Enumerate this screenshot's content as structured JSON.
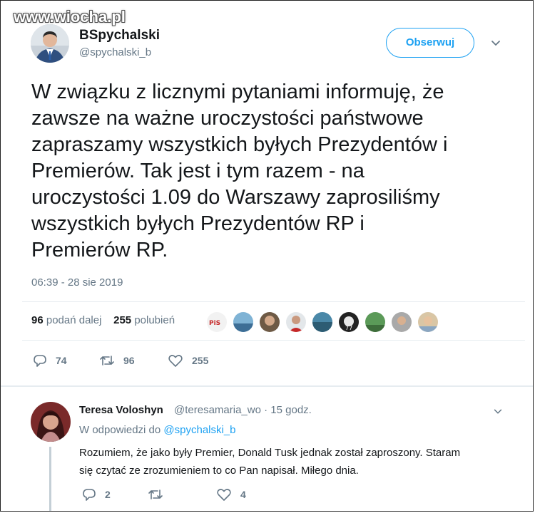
{
  "watermark": "www.wiocha.pl",
  "tweet": {
    "author_name": "BSpychalski",
    "author_handle": "@spychalski_b",
    "follow_label": "Obserwuj",
    "text": "W związku z licznymi pytaniami informuję, że\nzawsze na ważne uroczystości państwowe\nzapraszamy wszystkich byłych Prezydentów i\nPremierów. Tak jest i tym razem - na\nuroczystości 1.09 do Warszawy zaprosiliśmy\nwszystkich byłych Prezydentów RP i\nPremierów RP.",
    "timestamp": "06:39 - 28 sie 2019",
    "retweet_count": "96",
    "retweet_label": "podań dalej",
    "like_count": "255",
    "like_label": "polubień",
    "actions": {
      "reply_count": "74",
      "retweet_count": "96",
      "like_count": "255"
    },
    "liker_avatar_count": 9
  },
  "reply": {
    "author_name": "Teresa Voloshyn",
    "author_handle": "@teresamaria_wo",
    "separator": "·",
    "time_ago": "15 godz.",
    "reply_to_prefix": "W odpowiedzi do",
    "reply_to_handle": "@spychalski_b",
    "text": "Rozumiem, że jako były Premier, Donald Tusk jednak został zaproszony. Staram\nsię czytać ze zrozumieniem to co Pan napisał. Miłego dnia.",
    "actions": {
      "reply_count": "2",
      "retweet_count": "",
      "like_count": "4"
    }
  },
  "colors": {
    "accent": "#1da1f2",
    "text": "#14171a",
    "muted": "#657786",
    "divider": "#e6ecf0"
  }
}
